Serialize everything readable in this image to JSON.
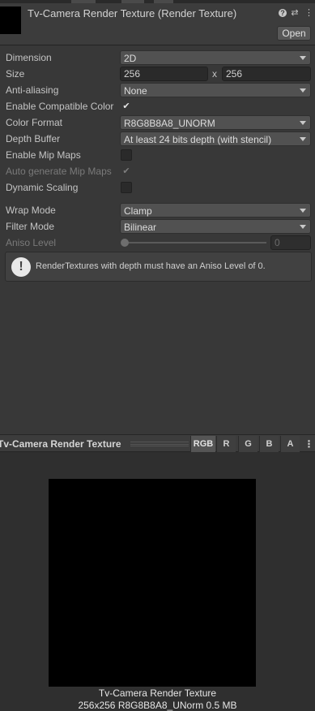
{
  "header": {
    "title": "Tv-Camera Render Texture (Render Texture)",
    "open_label": "Open",
    "icons": [
      "help-icon",
      "presets-icon",
      "more-vertical-icon"
    ]
  },
  "props": {
    "dimension": {
      "label": "Dimension",
      "value": "2D"
    },
    "size": {
      "label": "Size",
      "width": "256",
      "x": "x",
      "height": "256"
    },
    "anti_aliasing": {
      "label": "Anti-aliasing",
      "value": "None"
    },
    "compatible_color": {
      "label": "Enable Compatible Color",
      "checked": "✔"
    },
    "color_format": {
      "label": "Color Format",
      "value": "R8G8B8A8_UNORM"
    },
    "depth_buffer": {
      "label": "Depth Buffer",
      "value": "At least 24 bits depth (with stencil)"
    },
    "mip_maps": {
      "label": "Enable Mip Maps",
      "checked": ""
    },
    "auto_mip": {
      "label": "Auto generate Mip Maps",
      "checked": "✔"
    },
    "dynamic_scaling": {
      "label": "Dynamic Scaling",
      "checked": ""
    },
    "wrap_mode": {
      "label": "Wrap Mode",
      "value": "Clamp"
    },
    "filter_mode": {
      "label": "Filter Mode",
      "value": "Bilinear"
    },
    "aniso": {
      "label": "Aniso Level",
      "value": "0"
    }
  },
  "helpbox": {
    "icon": "info-icon",
    "glyph": "!",
    "message": "RenderTextures with depth must have an Aniso Level of 0."
  },
  "preview": {
    "title": "Tv-Camera Render Texture",
    "channels": [
      "RGB",
      "R",
      "G",
      "B",
      "A"
    ],
    "active_channel": "RGB",
    "caption_name": "Tv-Camera Render Texture",
    "caption_info": "256x256  R8G8B8A8_UNorm  0.5 MB"
  },
  "colors": {
    "panel": "#383838",
    "header": "#3c3c3c",
    "preview_bg": "#2f2f2f",
    "texture": "#000000"
  }
}
